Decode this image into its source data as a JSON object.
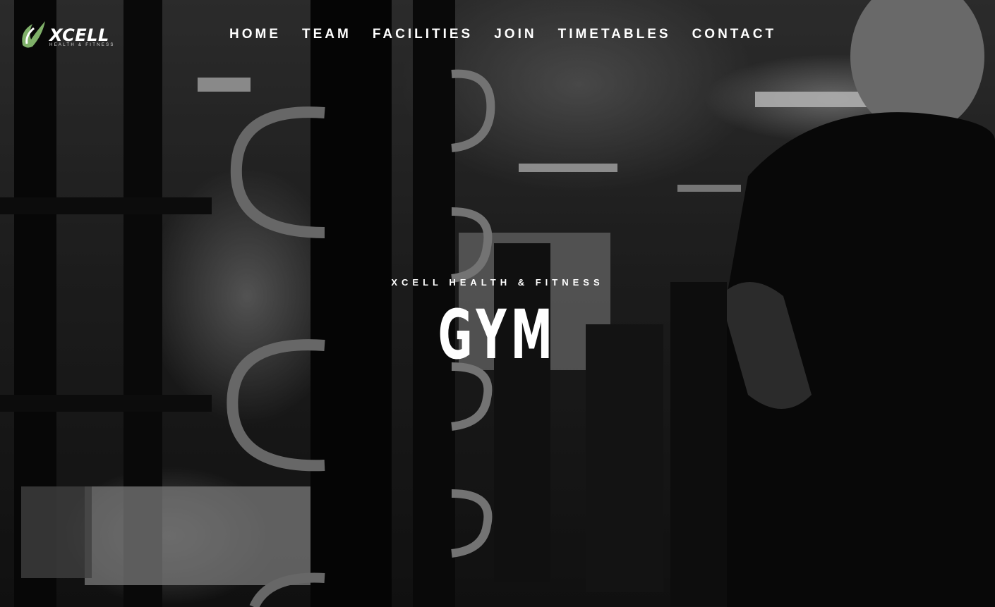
{
  "brand": {
    "name": "XCELL",
    "tagline": "HEALTH & FITNESS",
    "logo_icon": "swoosh-logo-icon",
    "accent": "#7fb069"
  },
  "nav": {
    "items": [
      {
        "label": "HOME"
      },
      {
        "label": "TEAM"
      },
      {
        "label": "FACILITIES"
      },
      {
        "label": "JOIN"
      },
      {
        "label": "TIMETABLES"
      },
      {
        "label": "CONTACT"
      }
    ]
  },
  "hero": {
    "kicker": "XCELL HEALTH & FITNESS",
    "title": "GYM",
    "background": "black-and-white gym interior photo"
  }
}
